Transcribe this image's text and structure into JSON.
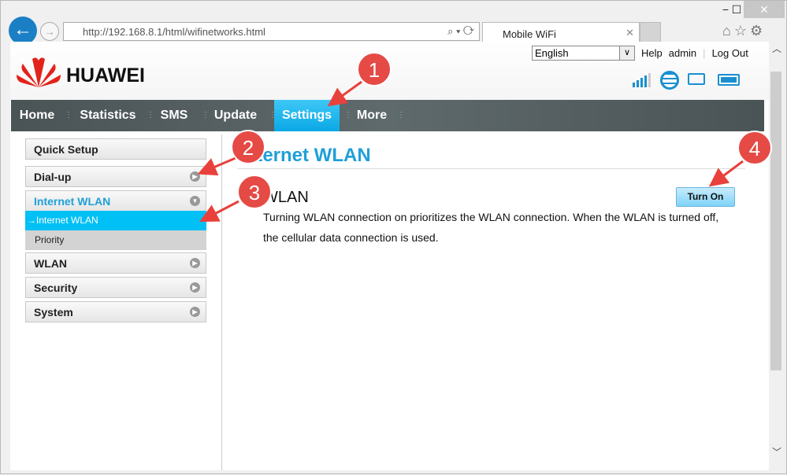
{
  "browser": {
    "url": "http://192.168.8.1/html/wifinetworks.html",
    "tab_title": "Mobile WiFi",
    "minimize": "−",
    "maximize": "☐",
    "close": "✕"
  },
  "header": {
    "brand": "HUAWEI",
    "language": "English",
    "help": "Help",
    "user": "admin",
    "logout": "Log Out"
  },
  "nav": {
    "items": [
      {
        "label": "Home"
      },
      {
        "label": "Statistics"
      },
      {
        "label": "SMS"
      },
      {
        "label": "Update"
      },
      {
        "label": "Settings",
        "active": true
      },
      {
        "label": "More"
      }
    ],
    "accent": "#1ab0e8"
  },
  "sidebar": {
    "items": [
      {
        "label": "Quick Setup"
      },
      {
        "label": "Dial-up"
      },
      {
        "label": "Internet WLAN",
        "expanded": true
      },
      {
        "label": "WLAN"
      },
      {
        "label": "Security"
      },
      {
        "label": "System"
      }
    ],
    "sub_items": [
      {
        "label": "Internet WLAN",
        "active": true
      },
      {
        "label": "Priority"
      }
    ]
  },
  "main": {
    "title": "Internet WLAN",
    "section": "WLAN",
    "button": "Turn On",
    "description_line1": "Turning WLAN connection on prioritizes the WLAN connection. When the WLAN is turned off,",
    "description_line2": "the cellular data connection is used."
  },
  "annotations": [
    "1",
    "2",
    "3",
    "4"
  ]
}
